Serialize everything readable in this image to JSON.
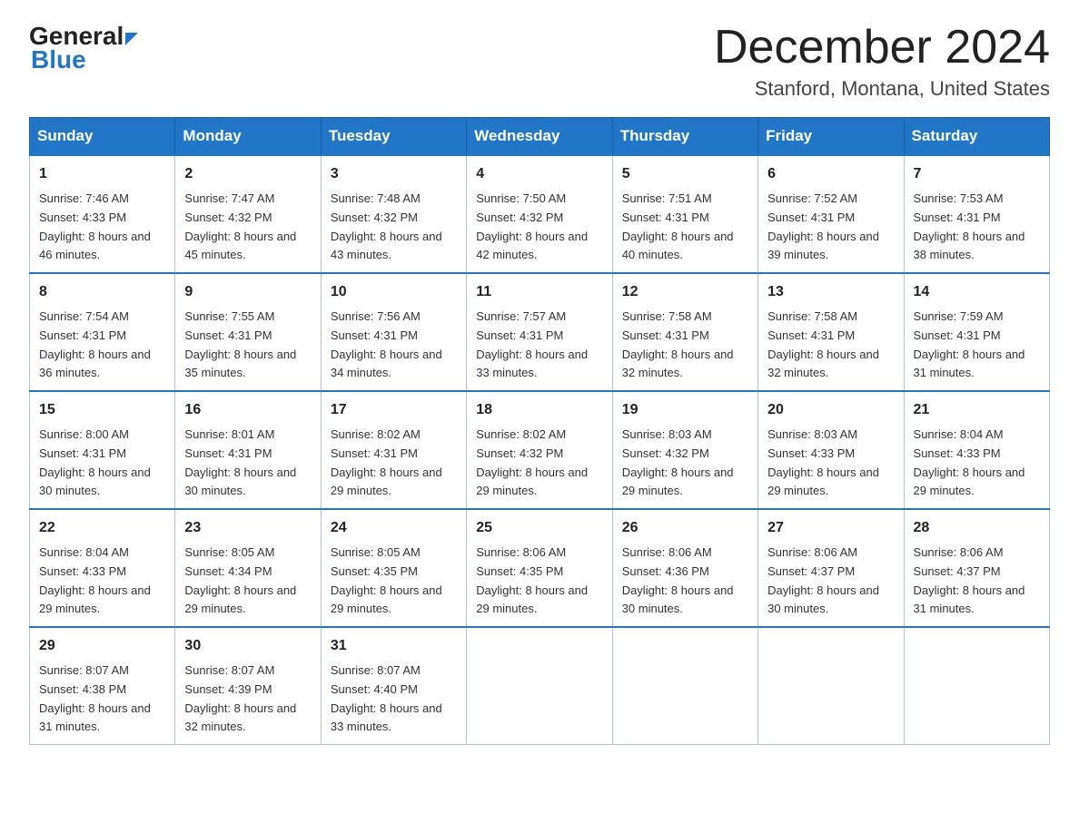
{
  "logo": {
    "general": "General",
    "triangle": "▶",
    "blue": "Blue"
  },
  "title": "December 2024",
  "subtitle": "Stanford, Montana, United States",
  "header": {
    "days": [
      "Sunday",
      "Monday",
      "Tuesday",
      "Wednesday",
      "Thursday",
      "Friday",
      "Saturday"
    ]
  },
  "weeks": [
    [
      {
        "day": "1",
        "sunrise": "7:46 AM",
        "sunset": "4:33 PM",
        "daylight": "8 hours and 46 minutes."
      },
      {
        "day": "2",
        "sunrise": "7:47 AM",
        "sunset": "4:32 PM",
        "daylight": "8 hours and 45 minutes."
      },
      {
        "day": "3",
        "sunrise": "7:48 AM",
        "sunset": "4:32 PM",
        "daylight": "8 hours and 43 minutes."
      },
      {
        "day": "4",
        "sunrise": "7:50 AM",
        "sunset": "4:32 PM",
        "daylight": "8 hours and 42 minutes."
      },
      {
        "day": "5",
        "sunrise": "7:51 AM",
        "sunset": "4:31 PM",
        "daylight": "8 hours and 40 minutes."
      },
      {
        "day": "6",
        "sunrise": "7:52 AM",
        "sunset": "4:31 PM",
        "daylight": "8 hours and 39 minutes."
      },
      {
        "day": "7",
        "sunrise": "7:53 AM",
        "sunset": "4:31 PM",
        "daylight": "8 hours and 38 minutes."
      }
    ],
    [
      {
        "day": "8",
        "sunrise": "7:54 AM",
        "sunset": "4:31 PM",
        "daylight": "8 hours and 36 minutes."
      },
      {
        "day": "9",
        "sunrise": "7:55 AM",
        "sunset": "4:31 PM",
        "daylight": "8 hours and 35 minutes."
      },
      {
        "day": "10",
        "sunrise": "7:56 AM",
        "sunset": "4:31 PM",
        "daylight": "8 hours and 34 minutes."
      },
      {
        "day": "11",
        "sunrise": "7:57 AM",
        "sunset": "4:31 PM",
        "daylight": "8 hours and 33 minutes."
      },
      {
        "day": "12",
        "sunrise": "7:58 AM",
        "sunset": "4:31 PM",
        "daylight": "8 hours and 32 minutes."
      },
      {
        "day": "13",
        "sunrise": "7:58 AM",
        "sunset": "4:31 PM",
        "daylight": "8 hours and 32 minutes."
      },
      {
        "day": "14",
        "sunrise": "7:59 AM",
        "sunset": "4:31 PM",
        "daylight": "8 hours and 31 minutes."
      }
    ],
    [
      {
        "day": "15",
        "sunrise": "8:00 AM",
        "sunset": "4:31 PM",
        "daylight": "8 hours and 30 minutes."
      },
      {
        "day": "16",
        "sunrise": "8:01 AM",
        "sunset": "4:31 PM",
        "daylight": "8 hours and 30 minutes."
      },
      {
        "day": "17",
        "sunrise": "8:02 AM",
        "sunset": "4:31 PM",
        "daylight": "8 hours and 29 minutes."
      },
      {
        "day": "18",
        "sunrise": "8:02 AM",
        "sunset": "4:32 PM",
        "daylight": "8 hours and 29 minutes."
      },
      {
        "day": "19",
        "sunrise": "8:03 AM",
        "sunset": "4:32 PM",
        "daylight": "8 hours and 29 minutes."
      },
      {
        "day": "20",
        "sunrise": "8:03 AM",
        "sunset": "4:33 PM",
        "daylight": "8 hours and 29 minutes."
      },
      {
        "day": "21",
        "sunrise": "8:04 AM",
        "sunset": "4:33 PM",
        "daylight": "8 hours and 29 minutes."
      }
    ],
    [
      {
        "day": "22",
        "sunrise": "8:04 AM",
        "sunset": "4:33 PM",
        "daylight": "8 hours and 29 minutes."
      },
      {
        "day": "23",
        "sunrise": "8:05 AM",
        "sunset": "4:34 PM",
        "daylight": "8 hours and 29 minutes."
      },
      {
        "day": "24",
        "sunrise": "8:05 AM",
        "sunset": "4:35 PM",
        "daylight": "8 hours and 29 minutes."
      },
      {
        "day": "25",
        "sunrise": "8:06 AM",
        "sunset": "4:35 PM",
        "daylight": "8 hours and 29 minutes."
      },
      {
        "day": "26",
        "sunrise": "8:06 AM",
        "sunset": "4:36 PM",
        "daylight": "8 hours and 30 minutes."
      },
      {
        "day": "27",
        "sunrise": "8:06 AM",
        "sunset": "4:37 PM",
        "daylight": "8 hours and 30 minutes."
      },
      {
        "day": "28",
        "sunrise": "8:06 AM",
        "sunset": "4:37 PM",
        "daylight": "8 hours and 31 minutes."
      }
    ],
    [
      {
        "day": "29",
        "sunrise": "8:07 AM",
        "sunset": "4:38 PM",
        "daylight": "8 hours and 31 minutes."
      },
      {
        "day": "30",
        "sunrise": "8:07 AM",
        "sunset": "4:39 PM",
        "daylight": "8 hours and 32 minutes."
      },
      {
        "day": "31",
        "sunrise": "8:07 AM",
        "sunset": "4:40 PM",
        "daylight": "8 hours and 33 minutes."
      },
      null,
      null,
      null,
      null
    ]
  ]
}
